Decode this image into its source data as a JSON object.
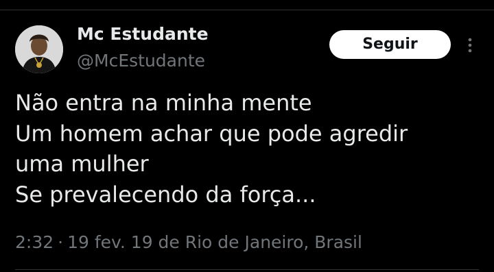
{
  "author": {
    "display_name": "Mc Estudante",
    "handle": "@McEstudante"
  },
  "actions": {
    "follow_label": "Seguir",
    "more_icon": "more-vertical-icon"
  },
  "tweet": {
    "lines": [
      "Não entra na minha mente",
      "Um homem achar que pode agredir",
      "uma mulher",
      "Se prevalecendo da força..."
    ],
    "time": "2:32",
    "separator": "·",
    "date": "19 fev. 19",
    "location": "de Rio de Janeiro, Brasil"
  },
  "colors": {
    "background": "#000000",
    "text_primary": "#e7e9ea",
    "text_secondary": "#71767b",
    "divider": "#2f3336",
    "button_bg": "#ffffff",
    "button_text": "#0f1419"
  }
}
